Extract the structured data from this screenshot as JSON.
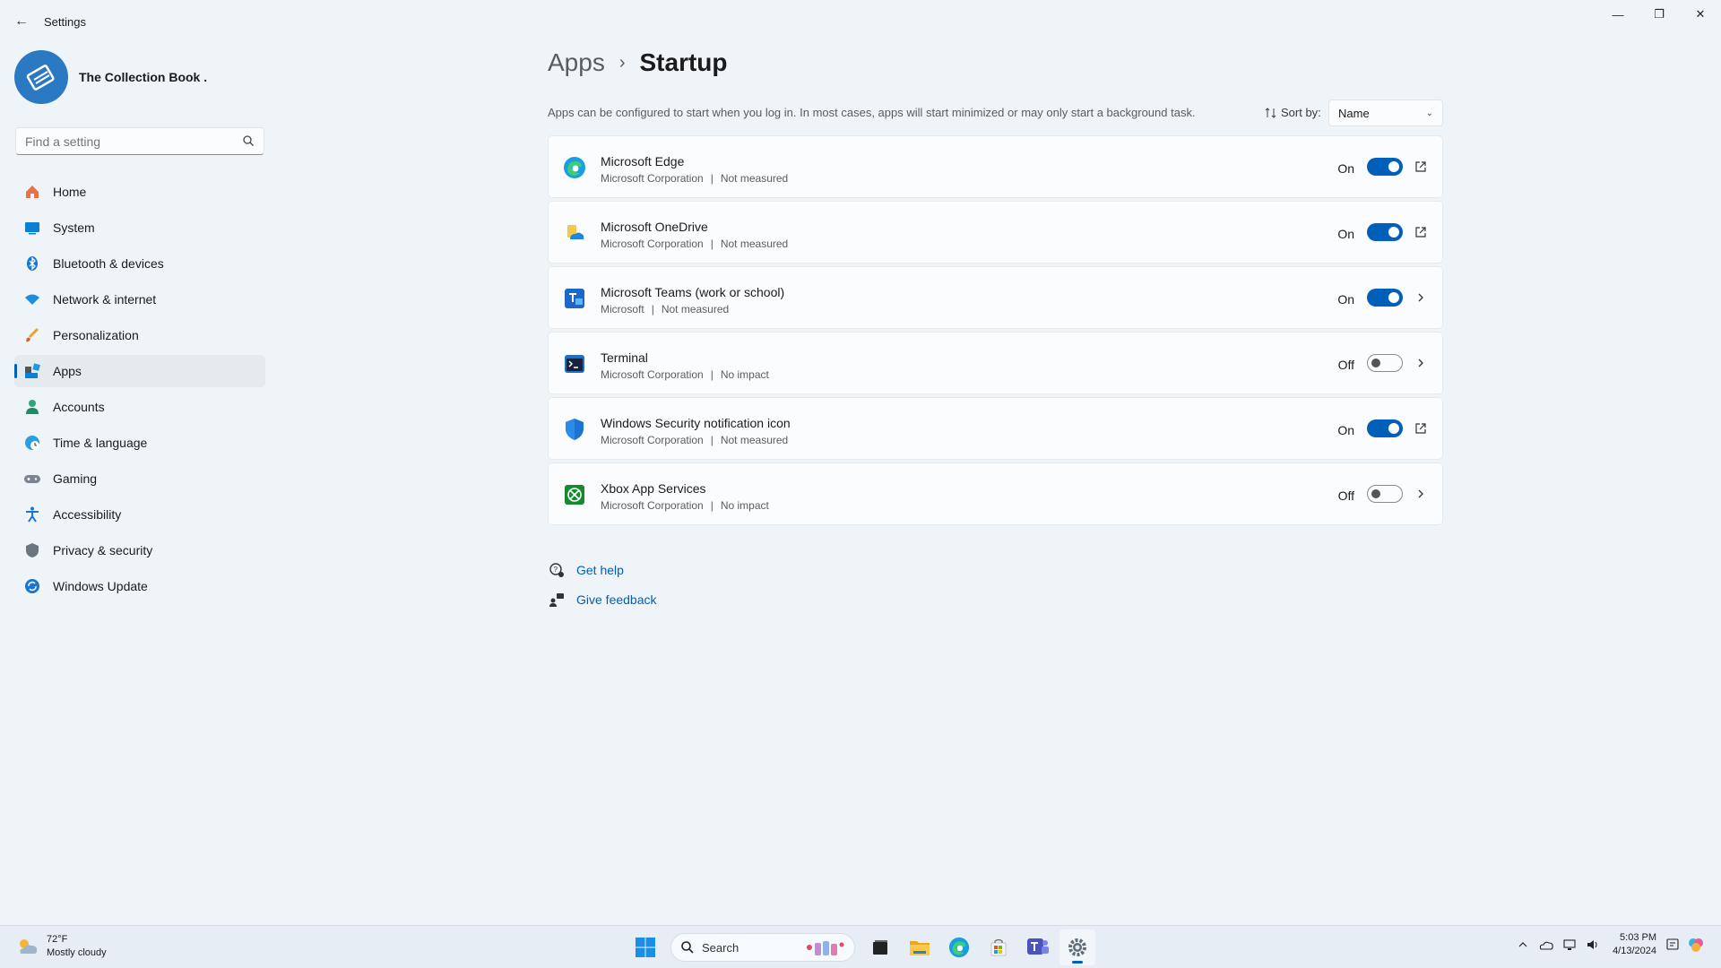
{
  "window": {
    "title": "Settings",
    "back_glyph": "←",
    "minimize_glyph": "—",
    "maximize_glyph": "❐",
    "close_glyph": "✕"
  },
  "profile": {
    "name": "The Collection Book ."
  },
  "search": {
    "placeholder": "Find a setting"
  },
  "sidebar": {
    "items": [
      {
        "label": "Home",
        "icon": "home-icon"
      },
      {
        "label": "System",
        "icon": "system-icon"
      },
      {
        "label": "Bluetooth & devices",
        "icon": "bluetooth-icon"
      },
      {
        "label": "Network & internet",
        "icon": "wifi-icon"
      },
      {
        "label": "Personalization",
        "icon": "brush-icon"
      },
      {
        "label": "Apps",
        "icon": "apps-icon",
        "active": true
      },
      {
        "label": "Accounts",
        "icon": "accounts-icon"
      },
      {
        "label": "Time & language",
        "icon": "globe-clock-icon"
      },
      {
        "label": "Gaming",
        "icon": "gamepad-icon"
      },
      {
        "label": "Accessibility",
        "icon": "accessibility-icon"
      },
      {
        "label": "Privacy & security",
        "icon": "shield-icon"
      },
      {
        "label": "Windows Update",
        "icon": "update-icon"
      }
    ]
  },
  "breadcrumb": {
    "parent": "Apps",
    "separator": "›",
    "current": "Startup"
  },
  "description": "Apps can be configured to start when you log in. In most cases, apps will start minimized or may only start a background task.",
  "sort": {
    "label": "Sort by:",
    "value": "Name",
    "chevron": "⌄"
  },
  "startup_apps": [
    {
      "name": "Microsoft Edge",
      "publisher": "Microsoft Corporation",
      "impact": "Not measured",
      "state": "On",
      "enabled": true,
      "action": "open-external-icon",
      "icon": "edge-icon"
    },
    {
      "name": "Microsoft OneDrive",
      "publisher": "Microsoft Corporation",
      "impact": "Not measured",
      "state": "On",
      "enabled": true,
      "action": "open-external-icon",
      "icon": "onedrive-icon"
    },
    {
      "name": "Microsoft Teams (work or school)",
      "publisher": "Microsoft",
      "impact": "Not measured",
      "state": "On",
      "enabled": true,
      "action": "chevron-right-icon",
      "icon": "teams-icon"
    },
    {
      "name": "Terminal",
      "publisher": "Microsoft Corporation",
      "impact": "No impact",
      "state": "Off",
      "enabled": false,
      "action": "chevron-right-icon",
      "icon": "terminal-icon"
    },
    {
      "name": "Windows Security notification icon",
      "publisher": "Microsoft Corporation",
      "impact": "Not measured",
      "state": "On",
      "enabled": true,
      "action": "open-external-icon",
      "icon": "windows-security-icon"
    },
    {
      "name": "Xbox App Services",
      "publisher": "Microsoft Corporation",
      "impact": "No impact",
      "state": "Off",
      "enabled": false,
      "action": "chevron-right-icon",
      "icon": "xbox-icon"
    }
  ],
  "meta_separator": "|",
  "help": {
    "get_help": "Get help",
    "give_feedback": "Give feedback"
  },
  "taskbar": {
    "weather": {
      "temp": "72°F",
      "condition": "Mostly cloudy"
    },
    "search_label": "Search",
    "pinned": [
      "windows-start-icon",
      "task-view-icon",
      "file-explorer-icon",
      "edge-icon",
      "store-icon",
      "teams-icon",
      "settings-icon"
    ],
    "clock": {
      "time": "5:03 PM",
      "date": "4/13/2024"
    }
  },
  "colors": {
    "accent": "#005fb8",
    "background": "#eff4f9",
    "card": "#fbfcfd"
  }
}
